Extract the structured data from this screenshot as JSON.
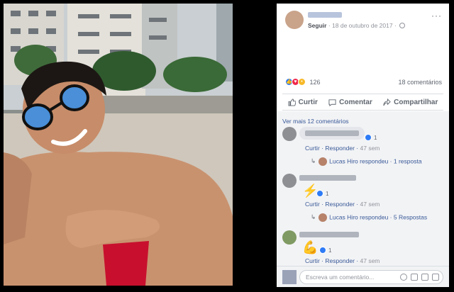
{
  "post": {
    "follow": "Seguir",
    "date": "18 de outubro de 2017",
    "more_options": "···"
  },
  "reactions": {
    "count": "126",
    "comments_count": "18 comentários"
  },
  "actions": {
    "like": "Curtir",
    "comment": "Comentar",
    "share": "Compartilhar"
  },
  "comments_section": {
    "view_more": "Ver mais 12 comentários",
    "items": [
      {
        "reaction_count": "1",
        "like": "Curtir",
        "reply": "Responder",
        "time": "47 sem",
        "reply_author": "Lucas Hiro",
        "reply_action": "respondeu",
        "reply_count": "1 resposta"
      },
      {
        "emoji": "⚡",
        "reaction_count": "1",
        "like": "Curtir",
        "reply": "Responder",
        "time": "47 sem",
        "reply_author": "Lucas Hiro",
        "reply_action": "respondeu",
        "reply_count": "5 Respostas"
      },
      {
        "emoji": "💪",
        "reaction_count": "1",
        "like": "Curtir",
        "reply": "Responder",
        "time": "47 sem"
      }
    ]
  },
  "composer": {
    "placeholder": "Escreva um comentário..."
  },
  "colors": {
    "link": "#385898",
    "like_blue": "#2e7bf6",
    "love_red": "#f0284a",
    "wow_yellow": "#f7b928"
  }
}
